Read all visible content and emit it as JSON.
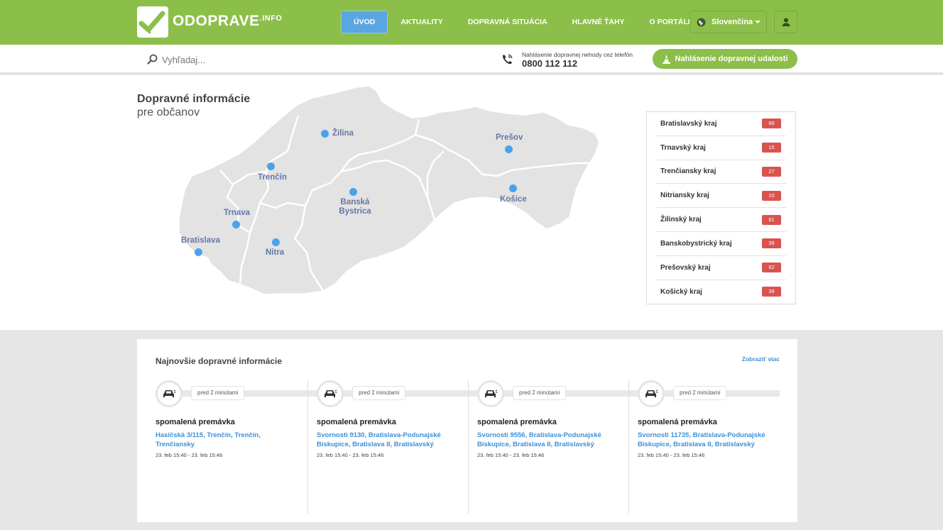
{
  "header": {
    "logo_text": "ODOPRAVE",
    "logo_suffix": ".INFO",
    "nav": [
      "ÚVOD",
      "AKTUALITY",
      "DOPRAVNÁ SITUÁCIA",
      "HLAVNÉ ŤAHY",
      "O PORTÁLI"
    ],
    "language": "Slovenčina",
    "colors": {
      "brand_green": "#8cbf4a",
      "active_blue": "#5aa6e0"
    }
  },
  "search": {
    "placeholder": "Vyhľadaj...",
    "phone_caption": "Nahlásenie dopravnej nehody cez telefón",
    "phone_number": "0800 112 112",
    "report_button": "Nahlásenie dopravnej udalosti"
  },
  "hero": {
    "title": "Dopravné informácie",
    "subtitle": "pre občanov",
    "cities": {
      "zilina": "Žilina",
      "presov": "Prešov",
      "trencin": "Trenčín",
      "banska1": "Banská",
      "banska2": "Bystrica",
      "kosice": "Košice",
      "trnava": "Trnava",
      "bratislava": "Bratislava",
      "nitra": "Nitra"
    }
  },
  "regions": [
    {
      "name": "Bratislavský kraj",
      "count": "66"
    },
    {
      "name": "Trnavský kraj",
      "count": "15"
    },
    {
      "name": "Trenčiansky kraj",
      "count": "27"
    },
    {
      "name": "Nitriansky kraj",
      "count": "10"
    },
    {
      "name": "Žilinský kraj",
      "count": "61"
    },
    {
      "name": "Banskobystrický kraj",
      "count": "39"
    },
    {
      "name": "Prešovský kraj",
      "count": "62"
    },
    {
      "name": "Košický kraj",
      "count": "39"
    }
  ],
  "news": {
    "title": "Najnovšie dopravné informácie",
    "more": "Zobraziť viac",
    "items": [
      {
        "ago": "pred 2 minútami",
        "type": "spomalená premávka",
        "location": "Hasičská 3/115, Trenčín, Trenčín, Trenčiansky",
        "time": "23. feb 15:40 - 23. feb 15:46"
      },
      {
        "ago": "pred 2 minútami",
        "type": "spomalená premávka",
        "location": "Svornosti 9130, Bratislava-Podunajské Biskupice, Bratislava II, Bratislavský",
        "time": "23. feb 15:40 - 23. feb 15:46"
      },
      {
        "ago": "pred 2 minútami",
        "type": "spomalená premávka",
        "location": "Svornosti 9556, Bratislava-Podunajské Biskupice, Bratislava II, Bratislavský",
        "time": "23. feb 15:40 - 23. feb 15:46"
      },
      {
        "ago": "pred 2 minútami",
        "type": "spomalená premávka",
        "location": "Svornosti 11735, Bratislava-Podunajské Biskupice, Bratislava II, Bratislavský",
        "time": "23. feb 15:40 - 23. feb 15:46"
      }
    ]
  }
}
